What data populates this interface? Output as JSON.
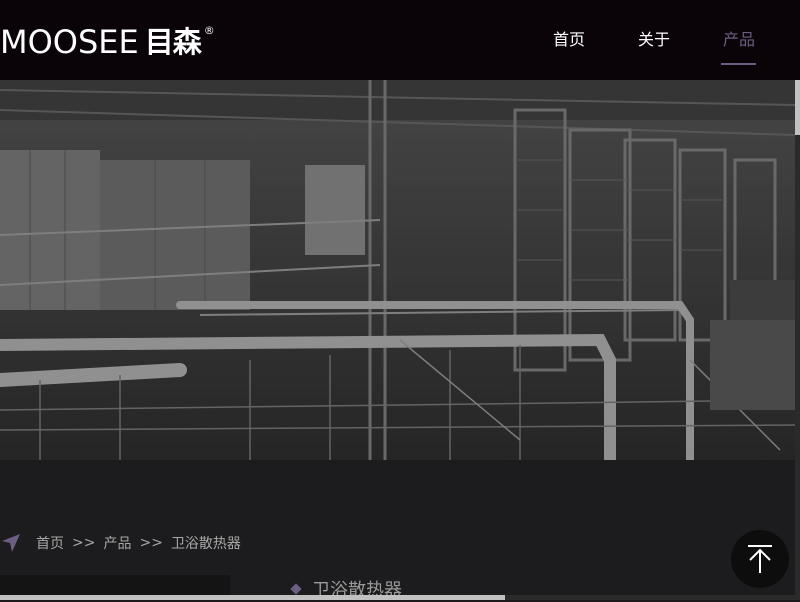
{
  "header": {
    "logo": {
      "text_en": "MOOSEE",
      "text_cn": "目森",
      "registered": "®"
    },
    "nav": [
      {
        "label": "首页",
        "active": false
      },
      {
        "label": "关于",
        "active": false
      },
      {
        "label": "产品",
        "active": true
      }
    ]
  },
  "hero": {
    "icon": "factory-image"
  },
  "breadcrumb": {
    "icon": "location-arrow-icon",
    "items": [
      "首页",
      "产品",
      "卫浴散热器"
    ],
    "separator": ">>"
  },
  "category": {
    "title": "卫浴散热器"
  },
  "back_to_top": {
    "icon": "arrow-up-icon"
  },
  "colors": {
    "header_bg": "#0a0408",
    "page_bg": "#1c1c1e",
    "accent": "#6c5e82",
    "text_muted": "#a7a7a7"
  }
}
